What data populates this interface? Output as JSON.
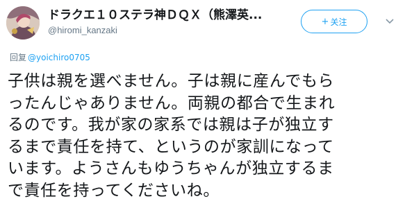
{
  "author": {
    "display_name": "ドラクエ１０ステラ神ＤＱＸ（熊澤英...",
    "handle": "@hiromi_kanzaki",
    "avatar_icon": "avatar-image"
  },
  "follow_button": {
    "label": "关注",
    "icon": "plus-icon"
  },
  "menu": {
    "icon": "chevron-down-icon"
  },
  "reply": {
    "prefix": "回复",
    "mention": "@yoichiro0705"
  },
  "tweet": {
    "lines": [
      "子供は親を選べません。子は親に産んでもら",
      "ったんじゃありません。両親の都合で生まれ",
      "るのです。我が家の家系では親は子が独立す",
      "るまで責任を持て、というのが家訓になって",
      "います。ようさんもゆうちゃんが独立するま",
      "で責任を持ってくださいね。"
    ]
  },
  "colors": {
    "accent": "#1da1f2",
    "text": "#14171a",
    "secondary": "#657786"
  }
}
